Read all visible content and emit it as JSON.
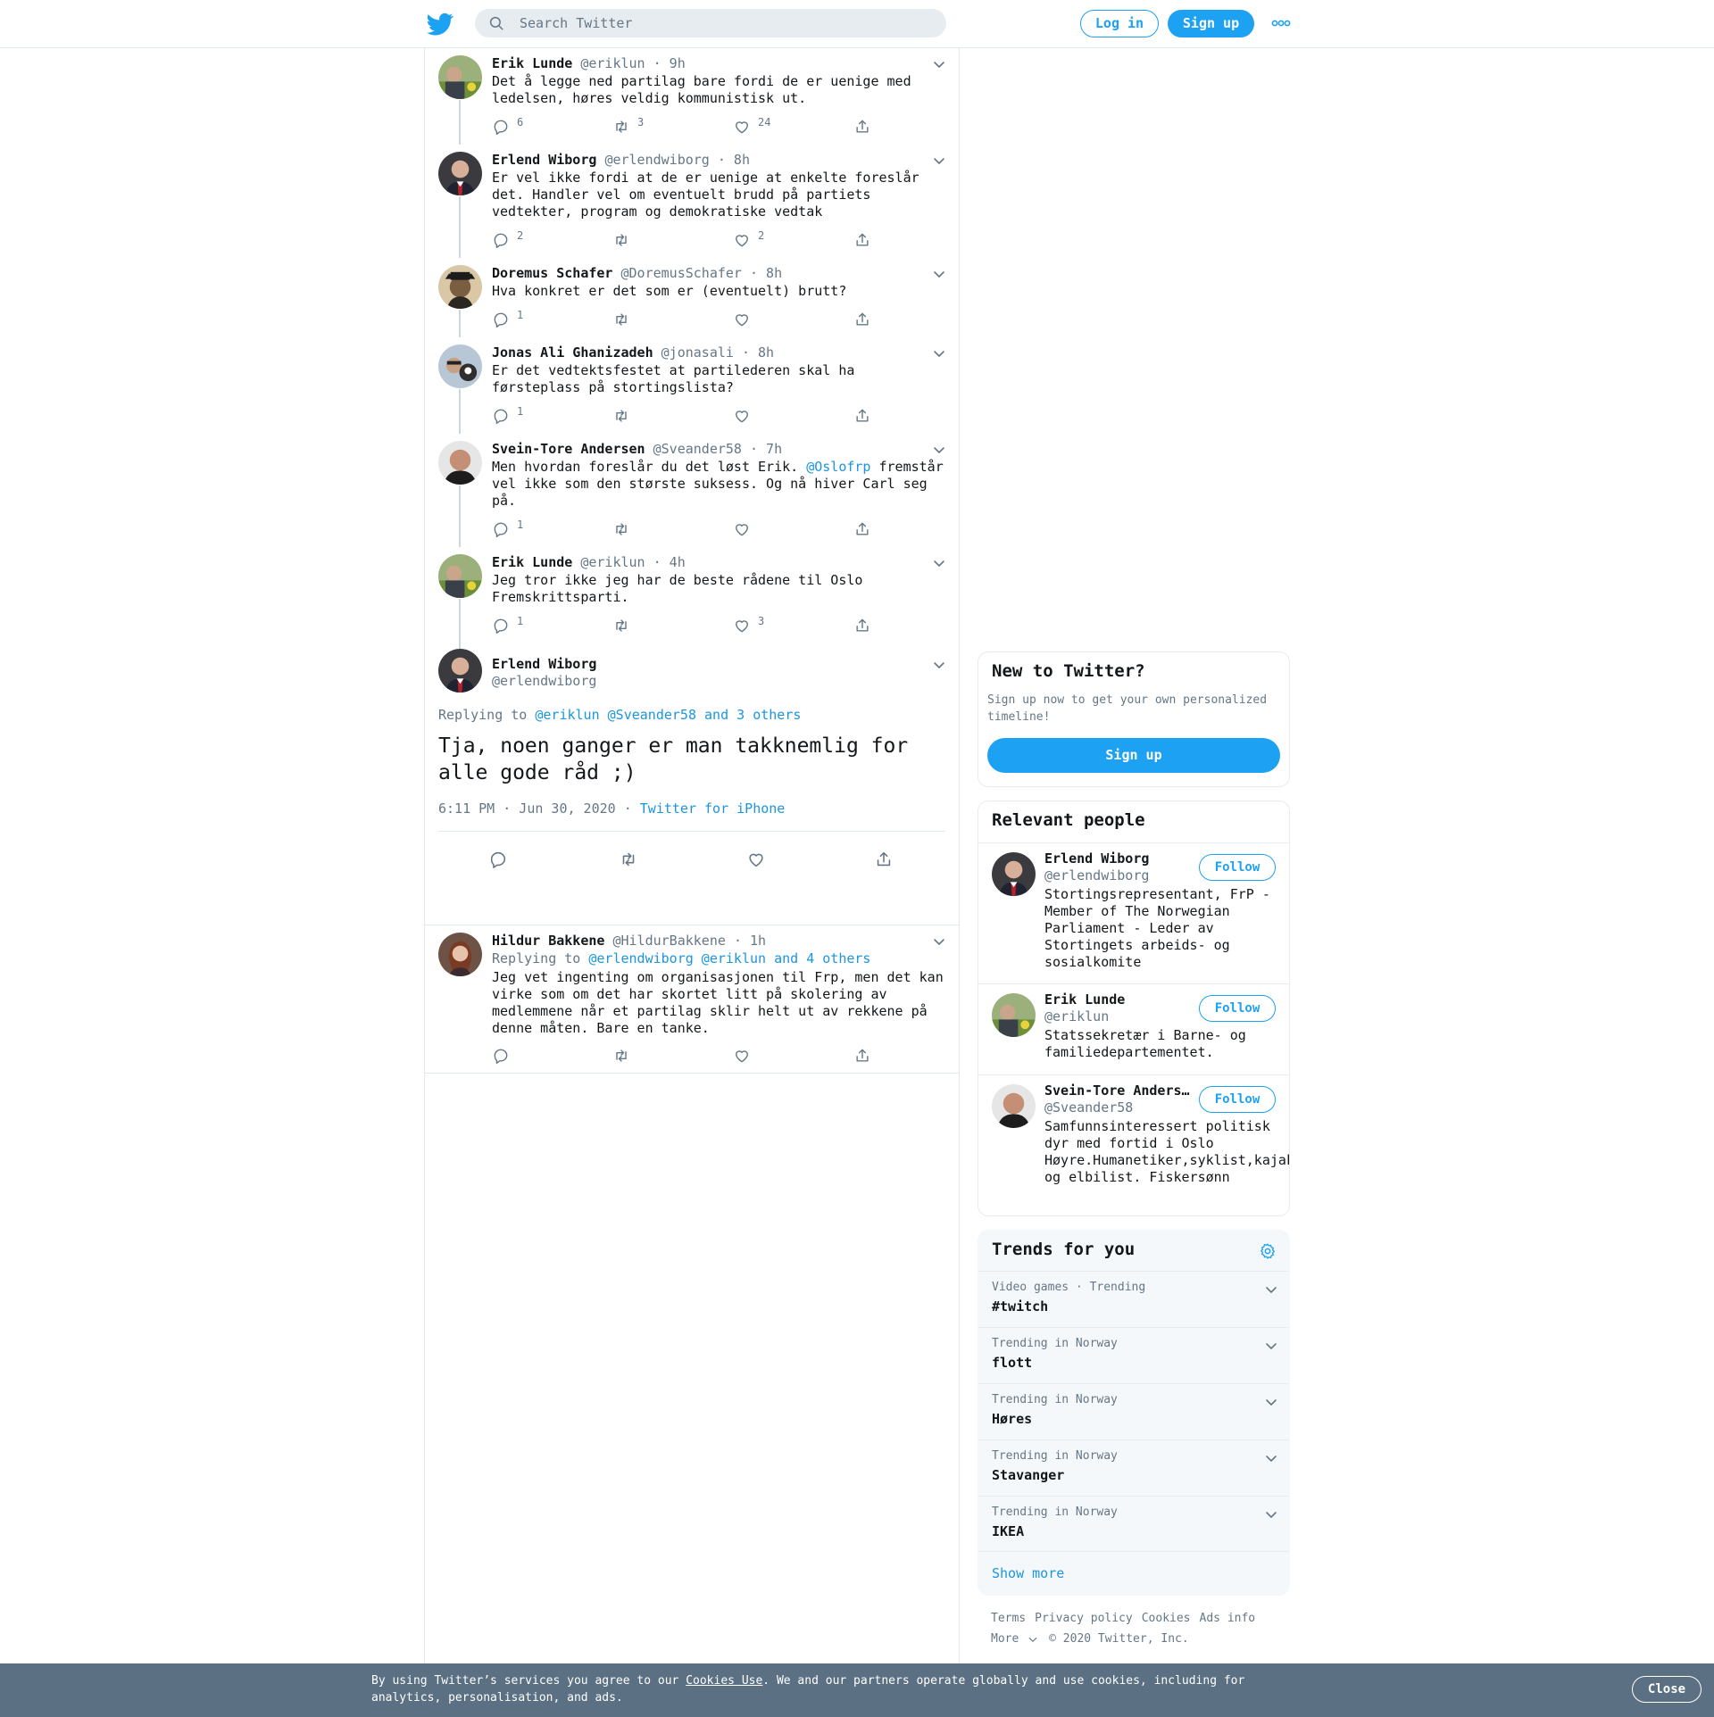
{
  "header": {
    "search_placeholder": "Search Twitter",
    "login_label": "Log in",
    "signup_label": "Sign up"
  },
  "replies_above": [
    {
      "name": "Erik Lunde",
      "handle": "@eriklun",
      "time": "· 9h",
      "text": "Det å legge ned partilag bare fordi de er uenige med ledelsen, høres veldig kommunistisk ut.",
      "replies": "6",
      "retweets": "3",
      "likes": "24"
    },
    {
      "name": "Erlend Wiborg",
      "handle": "@erlendwiborg",
      "time": "· 8h",
      "text": "Er vel ikke fordi at de er uenige at enkelte foreslår det. Handler vel om eventuelt brudd på partiets vedtekter, program og demokratiske vedtak",
      "replies": "2",
      "retweets": "",
      "likes": "2"
    },
    {
      "name": "Doremus Schafer",
      "handle": "@DoremusSchafer",
      "time": "· 8h",
      "text": "Hva konkret er det som er (eventuelt) brutt?",
      "replies": "1",
      "retweets": "",
      "likes": ""
    },
    {
      "name": "Jonas Ali Ghanizadeh",
      "handle": "@jonasali",
      "time": "· 8h",
      "text": "Er det vedtektsfestet at partilederen skal ha førsteplass på stortingslista?",
      "replies": "1",
      "retweets": "",
      "likes": ""
    },
    {
      "name": "Svein-Tore Andersen",
      "handle": "@Sveander58",
      "time": "· 7h",
      "text_before": "Men hvordan foreslår du det løst Erik. ",
      "mention": "@Oslofrp",
      "text_after": " fremstår vel ikke som den største suksess. Og nå hiver Carl seg på.",
      "replies": "1",
      "retweets": "",
      "likes": ""
    },
    {
      "name": "Erik Lunde",
      "handle": "@eriklun",
      "time": "· 4h",
      "text": "Jeg tror ikke jeg har de beste rådene til Oslo Fremskrittsparti.",
      "replies": "1",
      "retweets": "",
      "likes": "3"
    }
  ],
  "main_tweet": {
    "name": "Erlend Wiborg",
    "handle": "@erlendwiborg",
    "replying_prefix": "Replying to",
    "replying_to": "@eriklun @Sveander58 and 3 others",
    "text": "Tja, noen ganger er man takknemlig for alle gode råd ;)",
    "timestamp": "6:11 PM · Jun 30, 2020",
    "source_sep": "·",
    "source": "Twitter for iPhone"
  },
  "reply_below": {
    "name": "Hildur Bakkene",
    "handle": "@HildurBakkene",
    "time": "· 1h",
    "replying_prefix": "Replying to",
    "replying_to": "@erlendwiborg @eriklun and 4 others",
    "text": "Jeg vet ingenting om organisasjonen til Frp, men det kan virke som om det har skortet litt på skolering av medlemmene når et partilag sklir helt ut av rekkene på denne måten. Bare en tanke."
  },
  "new_to_twitter": {
    "title": "New to Twitter?",
    "text": "Sign up now to get your own personalized timeline!",
    "button": "Sign up"
  },
  "relevant_people": {
    "title": "Relevant people",
    "follow_label": "Follow",
    "people": [
      {
        "name": "Erlend Wiborg",
        "handle": "@erlendwiborg",
        "bio": "Stortingsrepresentant, FrP - Member of The Norwegian Parliament - Leder av Stortingets arbeids- og sosialkomite"
      },
      {
        "name": "Erik Lunde",
        "handle": "@eriklun",
        "bio": "Statssekretær i Barne- og familiedepartementet."
      },
      {
        "name": "Svein-Tore Andersen",
        "handle": "@Sveander58",
        "bio": "Samfunnsinteressert politisk dyr med fortid i Oslo Høyre.Humanetiker,syklist,kajakkpadler og elbilist. Fiskersønn"
      }
    ]
  },
  "trends": {
    "title": "Trends for you",
    "items": [
      {
        "category": "Video games · Trending",
        "name": "#twitch"
      },
      {
        "category": "Trending in Norway",
        "name": "flott"
      },
      {
        "category": "Trending in Norway",
        "name": "Høres"
      },
      {
        "category": "Trending in Norway",
        "name": "Stavanger"
      },
      {
        "category": "Trending in Norway",
        "name": "IKEA"
      }
    ],
    "show_more": "Show more"
  },
  "footer": {
    "links": [
      "Terms",
      "Privacy policy",
      "Cookies",
      "Ads info"
    ],
    "more": "More",
    "copyright": "© 2020 Twitter, Inc."
  },
  "cookie_banner": {
    "text_before": "By using Twitter’s services you agree to our ",
    "link": "Cookies Use",
    "text_after": ". We and our partners operate globally and use cookies, including for analytics, personalisation, and ads.",
    "close": "Close"
  },
  "colors": {
    "accent": "#1da1f2",
    "link": "#1b95e0",
    "muted": "#657786",
    "banner": "#5b7083"
  }
}
